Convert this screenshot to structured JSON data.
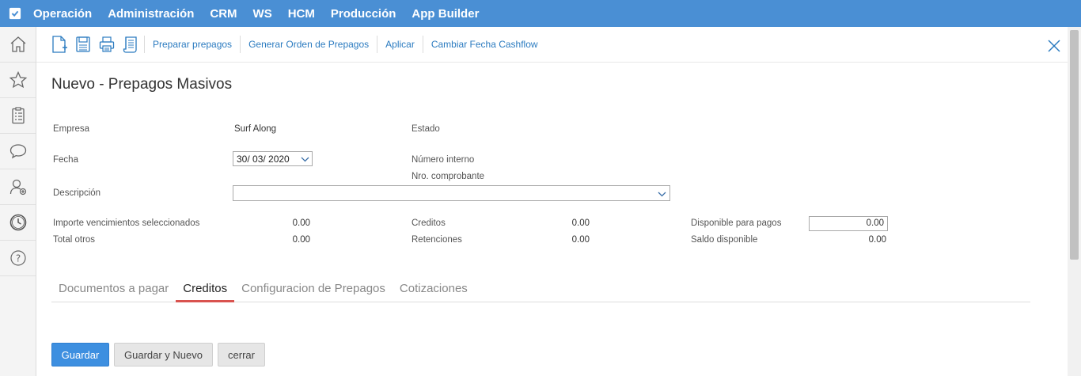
{
  "topnav": {
    "items": [
      "Operación",
      "Administración",
      "CRM",
      "WS",
      "HCM",
      "Producción",
      "App Builder"
    ]
  },
  "sidebar": {
    "icons": [
      "home-icon",
      "star-icon",
      "clipboard-icon",
      "chat-icon",
      "add-user-icon",
      "clock-icon",
      "help-icon"
    ]
  },
  "toolbar": {
    "links": [
      "Preparar prepagos",
      "Generar Orden de Prepagos",
      "Aplicar",
      "Cambiar Fecha Cashflow"
    ]
  },
  "page": {
    "title": "Nuevo - Prepagos Masivos"
  },
  "form": {
    "empresa_label": "Empresa",
    "empresa_value": "Surf Along",
    "estado_label": "Estado",
    "fecha_label": "Fecha",
    "fecha_value": "30/ 03/ 2020",
    "numero_interno_label": "Número interno",
    "nro_comprobante_label": "Nro. comprobante",
    "descripcion_label": "Descripción",
    "importe_label": "Importe vencimientos seleccionados",
    "importe_value": "0.00",
    "total_otros_label": "Total otros",
    "total_otros_value": "0.00",
    "creditos_label": "Creditos",
    "creditos_value": "0.00",
    "retenciones_label": "Retenciones",
    "retenciones_value": "0.00",
    "disponible_label": "Disponible para pagos",
    "disponible_value": "0.00",
    "saldo_label": "Saldo disponible",
    "saldo_value": "0.00"
  },
  "tabs": {
    "items": [
      "Documentos a pagar",
      "Creditos",
      "Configuracion de Prepagos",
      "Cotizaciones"
    ],
    "active": "Creditos"
  },
  "buttons": {
    "save": "Guardar",
    "save_new": "Guardar y Nuevo",
    "close": "cerrar"
  },
  "colors": {
    "topnav": "#4a8fd4",
    "link": "#2b7bc0",
    "primary_button": "#3d8fe0",
    "active_tab_underline": "#d9534f"
  }
}
